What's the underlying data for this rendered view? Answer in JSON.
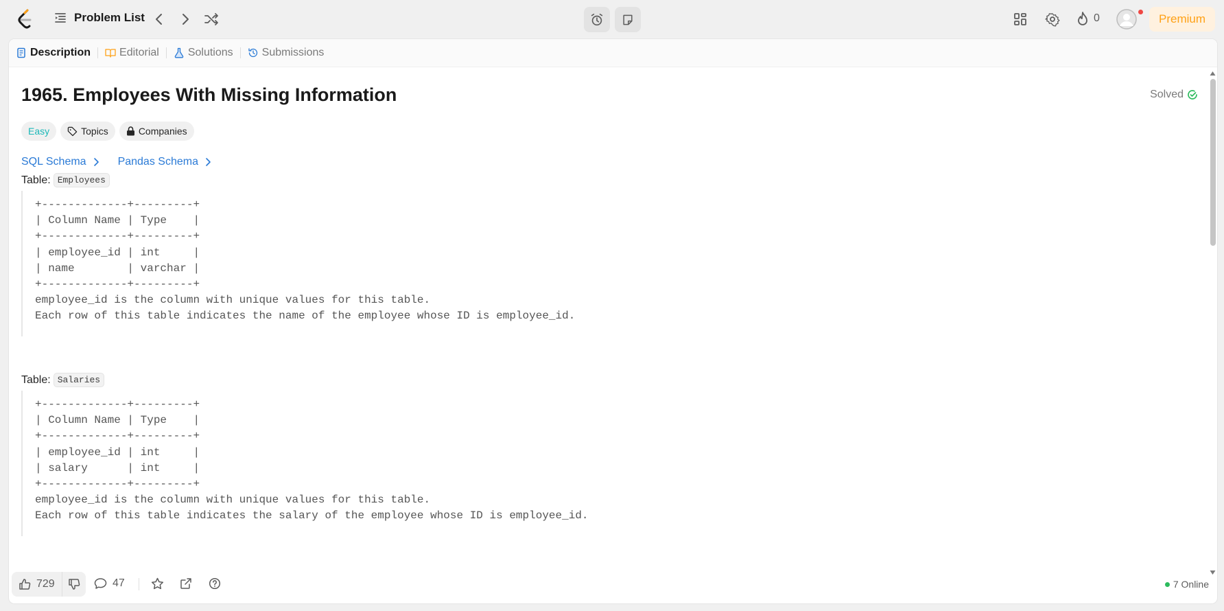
{
  "header": {
    "problem_list_label": "Problem List",
    "streak_count": "0",
    "premium_label": "Premium"
  },
  "tabs": [
    {
      "label": "Description",
      "active": true
    },
    {
      "label": "Editorial",
      "active": false
    },
    {
      "label": "Solutions",
      "active": false
    },
    {
      "label": "Submissions",
      "active": false
    }
  ],
  "problem": {
    "title": "1965. Employees With Missing Information",
    "status": "Solved",
    "difficulty": "Easy",
    "topics_label": "Topics",
    "companies_label": "Companies",
    "sql_schema": "SQL Schema",
    "pandas_schema": "Pandas Schema",
    "table_prefix": "Table:",
    "table1_name": "Employees",
    "table1_schema": "+-------------+---------+\n| Column Name | Type    |\n+-------------+---------+\n| employee_id | int     |\n| name        | varchar |\n+-------------+---------+\nemployee_id is the column with unique values for this table.\nEach row of this table indicates the name of the employee whose ID is employee_id.",
    "table2_name": "Salaries",
    "table2_schema": "+-------------+---------+\n| Column Name | Type    |\n+-------------+---------+\n| employee_id | int     |\n| salary      | int     |\n+-------------+---------+\nemployee_id is the column with unique values for this table.\nEach row of this table indicates the salary of the employee whose ID is employee_id."
  },
  "footer": {
    "likes": "729",
    "comments": "47",
    "online": "7 Online"
  },
  "colors": {
    "accent": "#ffa116",
    "easy": "#1cb8b8",
    "link": "#2a7ad6",
    "solved": "#2cbb5d"
  }
}
